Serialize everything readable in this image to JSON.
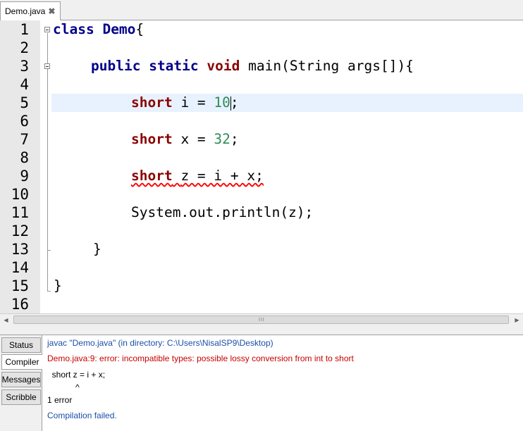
{
  "tab": {
    "title": "Demo.java"
  },
  "editor": {
    "line_numbers": [
      "1",
      "2",
      "3",
      "4",
      "5",
      "6",
      "7",
      "8",
      "9",
      "10",
      "11",
      "12",
      "13",
      "14",
      "15",
      "16"
    ],
    "lines": {
      "l1": {
        "kw": "class",
        "name": "Demo",
        "rest": "{"
      },
      "l3": {
        "kw1": "public",
        "kw2": "static",
        "kw3": "void",
        "rest": "main(String args[]){"
      },
      "l5": {
        "type": "short",
        "pre": "i = ",
        "num": "10",
        "end": ";"
      },
      "l7": {
        "type": "short",
        "pre": "x = ",
        "num": "32",
        "end": ";"
      },
      "l9": {
        "type": "short",
        "rest": "z = i + x;"
      },
      "l11": {
        "text": "System.out.println(z);"
      },
      "l13": {
        "text": "}"
      },
      "l15": {
        "text": "}"
      }
    }
  },
  "scrollbar": {
    "grip": "III"
  },
  "bottom_tabs": [
    "Status",
    "Compiler",
    "Messages",
    "Scribble"
  ],
  "active_tab": "Compiler",
  "output": {
    "line1": "javac \"Demo.java\" (in directory: C:\\Users\\NisalSP9\\Desktop)",
    "line2": "Demo.java:9: error: incompatible types: possible lossy conversion from int to short",
    "line3": "  short z = i + x;",
    "line4": "            ^",
    "line5": "1 error",
    "line6": "Compilation failed."
  },
  "colors": {
    "keyword": "#00008b",
    "primitive_type": "#8b0000",
    "number": "#2e8b57",
    "output_info": "#1b4ea8",
    "output_error": "#c80000",
    "current_line": "#e8f2fe"
  }
}
